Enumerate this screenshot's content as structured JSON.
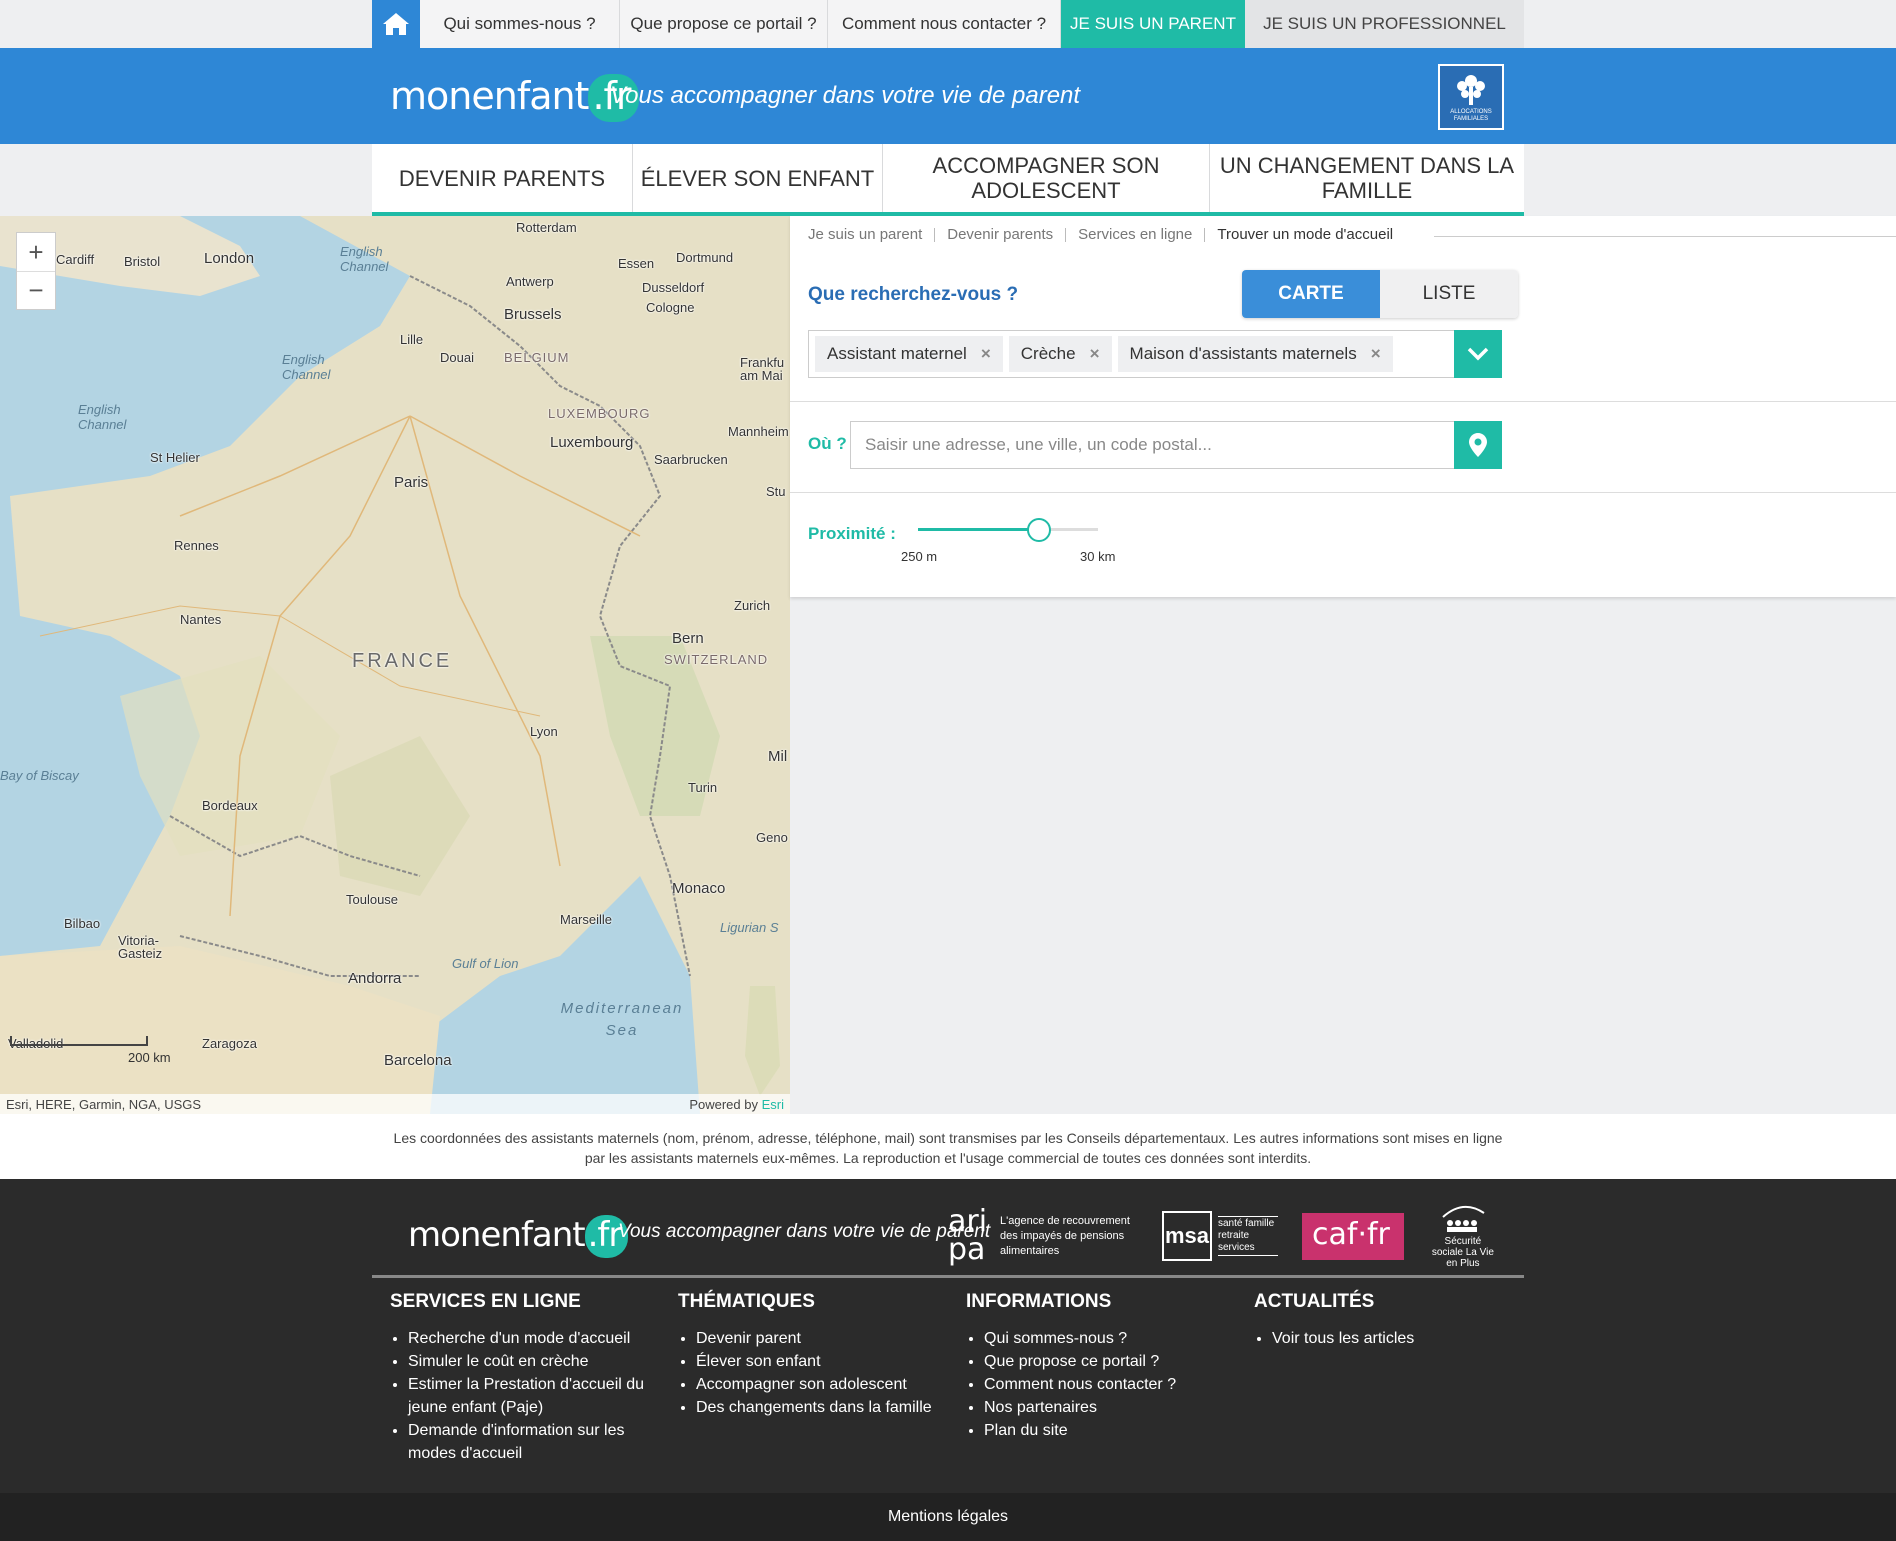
{
  "topbar": {
    "links": [
      "Qui sommes-nous ?",
      "Que propose ce portail ?",
      "Comment nous contacter ?"
    ],
    "parent": "JE SUIS UN PARENT",
    "pro": "JE SUIS UN PROFESSIONNEL"
  },
  "header": {
    "logo_main": "monenfant",
    "logo_ext": ".fr",
    "tagline": "Vous accompagner dans votre vie de parent",
    "caf_text": "ALLOCATIONS FAMILIALES"
  },
  "nav": [
    "Devenir parents",
    "Élever son enfant",
    "Accompagner son adolescent",
    "Un changement dans la famille"
  ],
  "map": {
    "labels": {
      "cardiff": "Cardiff",
      "bristol": "Bristol",
      "london": "London",
      "rotterdam": "Rotterdam",
      "essen": "Essen",
      "dortmund": "Dortmund",
      "antwerp": "Antwerp",
      "dusseldorf": "Dusseldorf",
      "cologne": "Cologne",
      "brussels": "Brussels",
      "lille": "Lille",
      "douai": "Douai",
      "belgium": "BELGIUM",
      "frankfurt": "Frankfu am Mai",
      "luxembourg_country": "LUXEMBOURG",
      "luxembourg": "Luxembourg",
      "mannheim": "Mannheim",
      "saarbrucken": "Saarbrucken",
      "sthelier": "St Helier",
      "paris": "Paris",
      "rennes": "Rennes",
      "nantes": "Nantes",
      "france": "FRANCE",
      "zurich": "Zurich",
      "bern": "Bern",
      "switzerland": "SWITZERLAND",
      "lyon": "Lyon",
      "bordeaux": "Bordeaux",
      "turin": "Turin",
      "mil": "Mil",
      "geno": "Geno",
      "toulouse": "Toulouse",
      "monaco": "Monaco",
      "bilbao": "Bilbao",
      "vitoria": "Vitoria-Gasteiz",
      "marseille": "Marseille",
      "andorra": "Andorra",
      "zaragoza": "Zaragoza",
      "barcelona": "Barcelona",
      "valladolid": "Valladolid",
      "stu": "Stu",
      "english_channel_1": "English Channel",
      "english_channel_2": "English Channel",
      "english_channel_3": "English Channel",
      "bay_of_biscay": "Bay of Biscay",
      "gulf_of_lion": "Gulf of Lion",
      "ligurian": "Ligurian S",
      "mediterranean": "Mediterranean Sea"
    },
    "scale": "200 km",
    "attribution": "Esri, HERE, Garmin, NGA, USGS",
    "powered": "Powered by",
    "esri": "Esri"
  },
  "panel": {
    "breadcrumb": [
      "Je suis un parent",
      "Devenir parents",
      "Services en ligne",
      "Trouver un mode d'accueil"
    ],
    "question": "Que recherchez-vous ?",
    "toggle_map": "CARTE",
    "toggle_list": "LISTE",
    "tags": [
      "Assistant maternel",
      "Crèche",
      "Maison d'assistants maternels"
    ],
    "tag_remove": "×",
    "where_label": "Où ?",
    "address_placeholder": "Saisir une adresse, une ville, un code postal...",
    "proximity_label": "Proximité :",
    "slider_min": "250 m",
    "slider_max": "30 km",
    "slider_position": 0.67
  },
  "disclaimer": "Les coordonnées des assistants maternels (nom, prénom, adresse, téléphone, mail) sont transmises par les Conseils départementaux. Les autres informations sont mises en ligne par les assistants maternels eux-mêmes. La reproduction et l'usage commercial de toutes ces données sont interdits.",
  "footer": {
    "logo_main": "monenfant",
    "logo_ext": ".fr",
    "tagline": "Vous accompagner dans votre vie de parent",
    "aripa_mark": "ari pa",
    "aripa_text": "L'agence de recouvrement des impayés de pensions alimentaires",
    "msa_mark": "msa",
    "msa_text": "santé famille retraite services",
    "caf": "caf·fr",
    "secu": "Sécurité sociale La Vie en Plus",
    "columns": [
      {
        "title": "Services en ligne",
        "items": [
          "Recherche d'un mode d'accueil",
          "Simuler le coût en crèche",
          "Estimer la Prestation d'accueil du jeune enfant (Paje)",
          "Demande d'information sur les modes d'accueil"
        ]
      },
      {
        "title": "Thématiques",
        "items": [
          "Devenir parent",
          "Élever son enfant",
          "Accompagner son adolescent",
          "Des changements dans la famille"
        ]
      },
      {
        "title": "Informations",
        "items": [
          "Qui sommes-nous ?",
          "Que propose ce portail ?",
          "Comment nous contacter ?",
          "Nos partenaires",
          "Plan du site"
        ]
      },
      {
        "title": "Actualités",
        "items": [
          "Voir tous les articles"
        ]
      }
    ],
    "legal": "Mentions légales"
  },
  "icons": {
    "home": "home-icon",
    "chevron": "chevron-down-icon",
    "pin": "map-pin-icon",
    "zoom_in": "plus-icon",
    "zoom_out": "minus-icon"
  },
  "colors": {
    "brand_blue": "#2e87d6",
    "accent_teal": "#1fbba6",
    "footer_dark": "#2b2b2b"
  }
}
